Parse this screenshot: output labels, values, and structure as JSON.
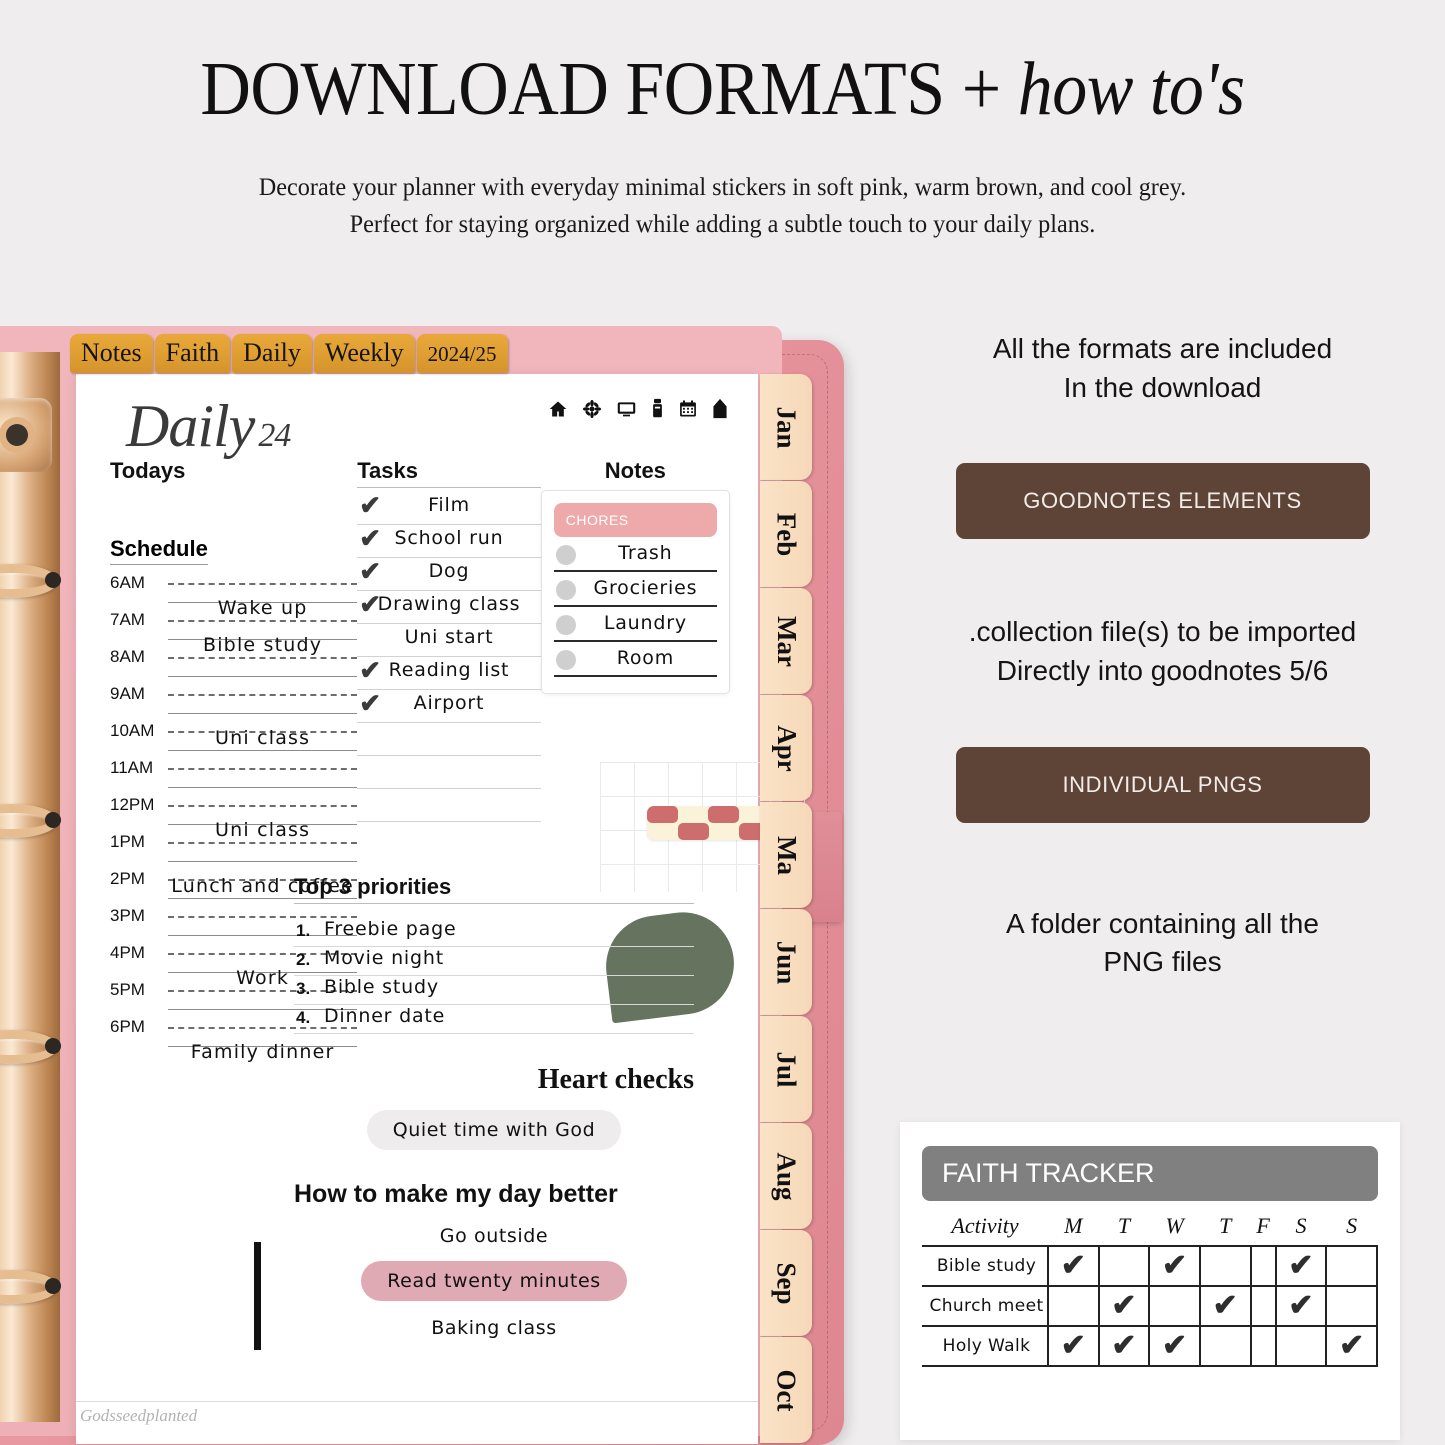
{
  "header": {
    "title_main": "DOWNLOAD FORMATS + ",
    "title_italic": "how to's",
    "sub_line1": "Decorate your planner with everyday minimal stickers in soft pink, warm brown, and cool grey.",
    "sub_line2": "Perfect for staying organized while adding a subtle touch to your daily plans."
  },
  "planner": {
    "top_tabs": [
      "Notes",
      "Faith",
      "Daily",
      "Weekly",
      "2024/25"
    ],
    "month_tabs": [
      "Jan",
      "Feb",
      "Mar",
      "Apr",
      "Ma",
      "Jun",
      "Jul",
      "Aug",
      "Sep",
      "Oct"
    ],
    "page_title": "Daily",
    "page_title_num": "24",
    "icons": [
      "home-icon",
      "flower-icon",
      "monitor-icon",
      "marker-icon",
      "calendar-icon",
      "bookmark-icon"
    ],
    "todays_label": "Todays",
    "schedule_label": "Schedule",
    "schedule": [
      {
        "time": "6AM",
        "entry": "Wake up",
        "pos": "lower"
      },
      {
        "time": "7AM",
        "entry": "Bible study",
        "pos": "lower"
      },
      {
        "time": "8AM",
        "entry": "",
        "pos": "lower"
      },
      {
        "time": "9AM",
        "entry": "",
        "pos": "lower"
      },
      {
        "time": "10AM",
        "entry": "Uni class",
        "pos": "upper"
      },
      {
        "time": "11AM",
        "entry": "",
        "pos": "lower"
      },
      {
        "time": "12PM",
        "entry": "Uni class",
        "pos": "lower"
      },
      {
        "time": "1PM",
        "entry": "",
        "pos": "lower"
      },
      {
        "time": "2PM",
        "entry": "Lunch and coffee",
        "pos": "upper"
      },
      {
        "time": "3PM",
        "entry": "",
        "pos": "lower"
      },
      {
        "time": "4PM",
        "entry": "Work",
        "pos": "lower"
      },
      {
        "time": "5PM",
        "entry": "",
        "pos": "lower"
      },
      {
        "time": "6PM",
        "entry": "Family dinner",
        "pos": "lower"
      }
    ],
    "tasks_label": "Tasks",
    "tasks": [
      {
        "text": "Film",
        "checked": true
      },
      {
        "text": "School run",
        "checked": true
      },
      {
        "text": "Dog",
        "checked": true
      },
      {
        "text": "Drawing class",
        "checked": true
      },
      {
        "text": "Uni start",
        "checked": false
      },
      {
        "text": "Reading list",
        "checked": true
      },
      {
        "text": "Airport",
        "checked": true
      },
      {
        "text": "",
        "checked": false
      },
      {
        "text": "",
        "checked": false
      },
      {
        "text": "",
        "checked": false
      }
    ],
    "notes_label": "Notes",
    "chores_badge": "CHORES",
    "chores": [
      "Trash",
      "Grocieries",
      "Laundry",
      "Room"
    ],
    "top3_label": "Top 3 priorities",
    "priorities": [
      {
        "num": "1.",
        "text": "Freebie page"
      },
      {
        "num": "2.",
        "text": "Movie night"
      },
      {
        "num": "3.",
        "text": "Bible study"
      },
      {
        "num": "4.",
        "text": "Dinner date"
      }
    ],
    "heart_checks_label": "Heart checks",
    "heart_check_item": "Quiet time with God",
    "better_label": "How to make my day better",
    "better_items": [
      "Go outside",
      "Read twenty minutes",
      "Baking class"
    ],
    "better_highlight_index": 1,
    "watermark": "Godsseedplanted"
  },
  "right": {
    "line1": "All the formats are included",
    "line2": "In the download",
    "button1": "GOODNOTES ELEMENTS",
    "line3": ".collection file(s) to be imported",
    "line4": "Directly into goodnotes 5/6",
    "button2": "INDIVIDUAL PNGS",
    "line5": "A folder containing all the",
    "line6": "PNG files"
  },
  "faith_tracker": {
    "title": "FAITH TRACKER",
    "activity_header": "Activity",
    "days": [
      "M",
      "T",
      "W",
      "T",
      "F",
      "S",
      "S"
    ],
    "check_glyph": "✔",
    "rows": [
      {
        "activity": "Bible study",
        "checks": [
          true,
          false,
          true,
          false,
          false,
          true,
          false
        ]
      },
      {
        "activity": "Church meet",
        "checks": [
          false,
          true,
          false,
          true,
          false,
          true,
          false
        ]
      },
      {
        "activity": "Holy Walk",
        "checks": [
          true,
          true,
          true,
          false,
          false,
          false,
          true
        ]
      }
    ]
  },
  "colors": {
    "background": "#efedee",
    "brown_button": "#5e4436",
    "tab_gold": "#e0a033",
    "month_tab": "#f7dcbd",
    "cover_pink": "#e5909a",
    "chores_pink": "#eeaaab",
    "highlight_pink": "#e0aab5",
    "leaf_green": "#66735f",
    "tracker_grey": "#808080"
  }
}
